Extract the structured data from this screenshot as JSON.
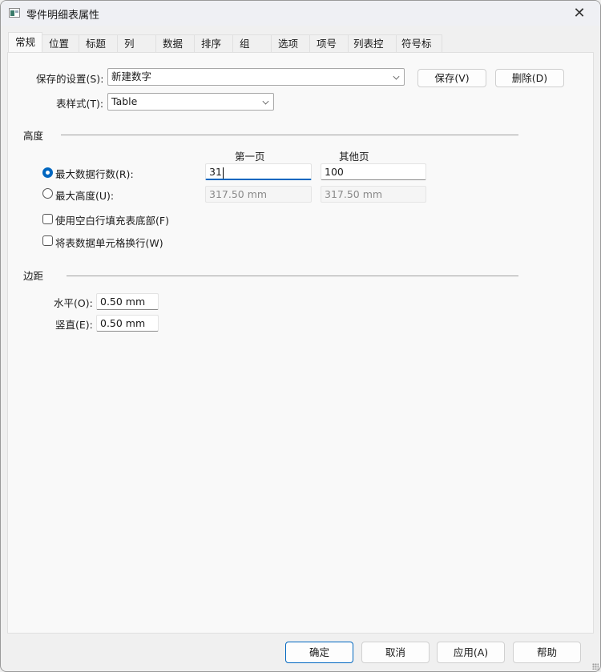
{
  "window": {
    "title": "零件明细表属性",
    "close_glyph": "✕"
  },
  "tabs": [
    {
      "label": "常规",
      "active": true
    },
    {
      "label": "位置"
    },
    {
      "label": "标题"
    },
    {
      "label": "列"
    },
    {
      "label": "数据"
    },
    {
      "label": "排序"
    },
    {
      "label": "组"
    },
    {
      "label": "选项"
    },
    {
      "label": "项号"
    },
    {
      "label": "列表控制"
    },
    {
      "label": "符号标注"
    }
  ],
  "general": {
    "saved_settings": {
      "label": "保存的设置(S):",
      "value": "新建数字",
      "save_button": "保存(V)",
      "delete_button": "删除(D)"
    },
    "table_style": {
      "label": "表样式(T):",
      "value": "Table"
    },
    "height": {
      "section_title": "高度",
      "col_first_page": "第一页",
      "col_other_pages": "其他页",
      "max_rows": {
        "label": "最大数据行数(R):",
        "selected": true,
        "first_page": "31",
        "other_pages": "100"
      },
      "max_height": {
        "label": "最大高度(U):",
        "selected": false,
        "first_page": "317.50 mm",
        "other_pages": "317.50 mm"
      },
      "fill_blank_rows": {
        "label": "使用空白行填充表底部(F)",
        "checked": false
      },
      "wrap_cells": {
        "label": "将表数据单元格换行(W)",
        "checked": false
      }
    },
    "margins": {
      "section_title": "边距",
      "horizontal": {
        "label": "水平(O):",
        "value": "0.50 mm"
      },
      "vertical": {
        "label": "竖直(E):",
        "value": "0.50 mm"
      }
    }
  },
  "footer": {
    "ok": "确定",
    "cancel": "取消",
    "apply": "应用(A)",
    "help": "帮助"
  },
  "colors": {
    "accent": "#0067c0"
  }
}
